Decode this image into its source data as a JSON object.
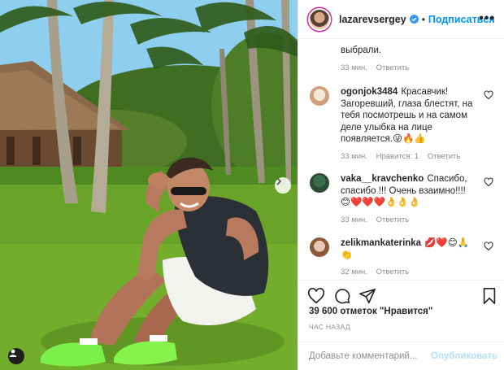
{
  "header": {
    "username": "lazarevsergey",
    "dot": "•",
    "follow_label": "Подписаться",
    "more": "•••"
  },
  "tail_comment": {
    "text": "выбрали.",
    "time": "33 мин.",
    "reply": "Ответить"
  },
  "comments": [
    {
      "user": "ogonjok3484",
      "text": "Красавчик! Загоревший, глаза блестят, на тебя посмотрешь и на самом деле улыбка на лице появляется.😜🔥👍",
      "time": "33 мин.",
      "likes": "Нравится: 1",
      "reply": "Ответить"
    },
    {
      "user": "vaka__kravchenko",
      "text": "Спасибо, спасибо !!! Очень взаимно!!!! 😊❤️❤️❤️👌👌👌",
      "time": "33 мин.",
      "reply": "Ответить"
    },
    {
      "user": "zelikmankaterinka",
      "text": "💋❤️😊🙏 👏",
      "time": "32 мин.",
      "reply": "Ответить"
    }
  ],
  "actions": {
    "likes": "39 600 отметок \"Нравится\"",
    "time": "ЧАС НАЗАД"
  },
  "add_comment": {
    "placeholder": "Добавьте комментарий...",
    "post_label": "Опубликовать"
  },
  "colors": {
    "link": "#0095f6",
    "muted": "#8e8e8e",
    "border": "#efefef"
  }
}
